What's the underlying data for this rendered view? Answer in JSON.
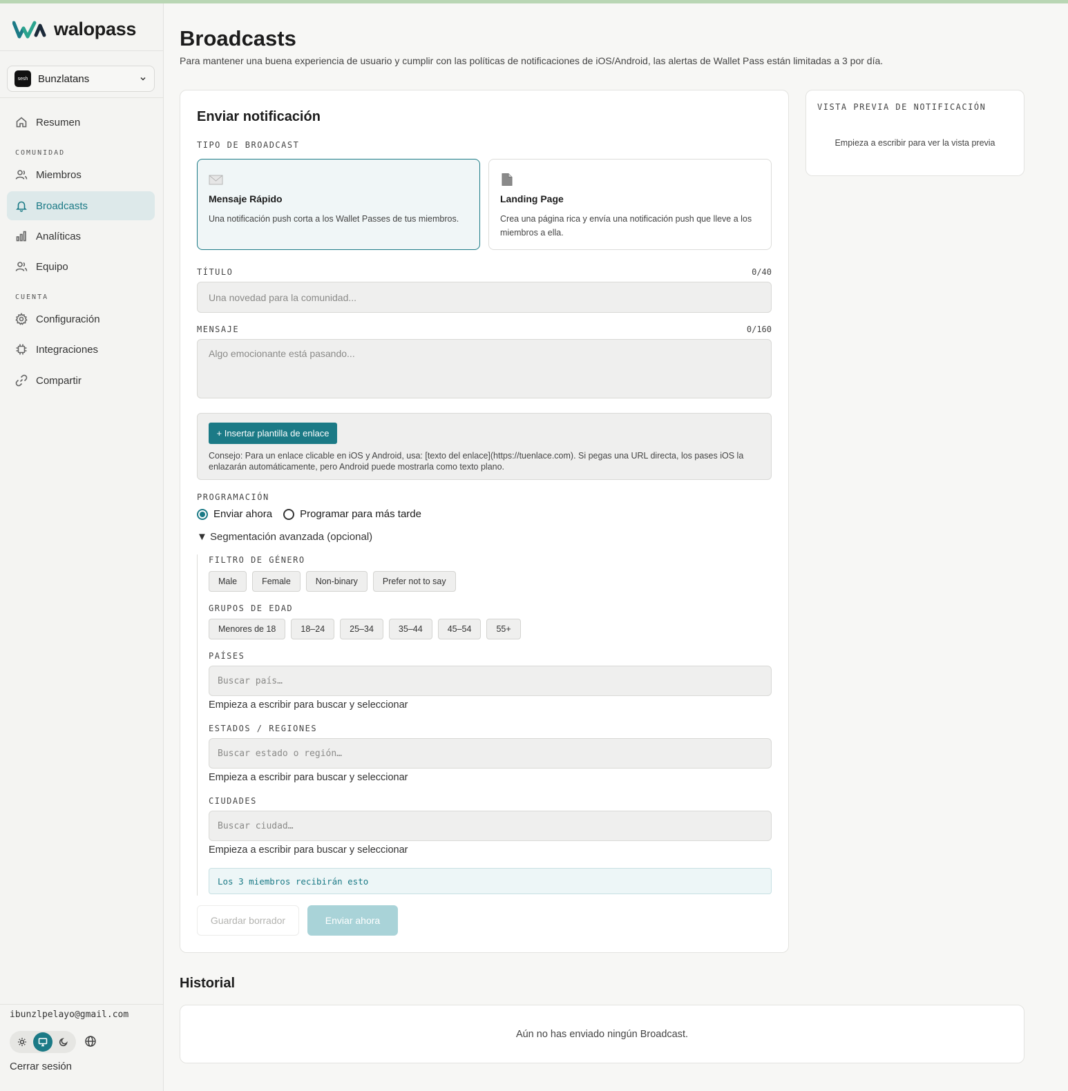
{
  "brand": {
    "name": "walopass",
    "accent": "#1b7a86"
  },
  "workspace": {
    "avatar_text": "sesh",
    "name": "Bunzlatans"
  },
  "nav": {
    "overview": "Resumen",
    "section_community": "COMUNIDAD",
    "members": "Miembros",
    "broadcasts": "Broadcasts",
    "analytics": "Analíticas",
    "team": "Equipo",
    "section_account": "CUENTA",
    "settings": "Configuración",
    "integrations": "Integraciones",
    "share": "Compartir"
  },
  "account": {
    "email": "ibunzlpelayo@gmail.com",
    "logout": "Cerrar sesión",
    "theme_selected": "system"
  },
  "header": {
    "title": "Broadcasts",
    "subtitle": "Para mantener una buena experiencia de usuario y cumplir con las políticas de notificaciones de iOS/Android, las alertas de Wallet Pass están limitadas a 3 por día."
  },
  "form": {
    "title": "Enviar notificación",
    "type_label": "TIPO DE BROADCAST",
    "types": [
      {
        "name": "Mensaje Rápido",
        "desc": "Una notificación push corta a los Wallet Passes de tus miembros.",
        "icon": "envelope-icon",
        "selected": true
      },
      {
        "name": "Landing Page",
        "desc": "Crea una página rica y envía una notificación push que lleve a los miembros a ella.",
        "icon": "document-icon",
        "selected": false
      }
    ],
    "title_field": {
      "label": "TÍTULO",
      "counter": "0/40",
      "placeholder": "Una novedad para la comunidad...",
      "value": ""
    },
    "message_field": {
      "label": "MENSAJE",
      "counter": "0/160",
      "placeholder": "Algo emocionante está pasando...",
      "value": ""
    },
    "link_template": {
      "button": "+ Insertar plantilla de enlace",
      "tip": "Consejo: Para un enlace clicable en iOS y Android, usa: [texto del enlace](https://tuenlace.com). Si pegas una URL directa, los pases iOS la enlazarán automáticamente, pero Android puede mostrarla como texto plano."
    },
    "schedule": {
      "label": "PROGRAMACIÓN",
      "options": [
        "Enviar ahora",
        "Programar para más tarde"
      ],
      "selected": "Enviar ahora"
    },
    "segmentation": {
      "toggle": "▼  Segmentación avanzada (opcional)",
      "gender_label": "FILTRO DE GÉNERO",
      "genders": [
        "Male",
        "Female",
        "Non-binary",
        "Prefer not to say"
      ],
      "age_label": "GRUPOS DE EDAD",
      "ages": [
        "Menores de 18",
        "18–24",
        "25–34",
        "35–44",
        "45–54",
        "55+"
      ],
      "countries": {
        "label": "PAÍSES",
        "placeholder": "Buscar país…",
        "help": "Empieza a escribir para buscar y seleccionar"
      },
      "regions": {
        "label": "ESTADOS / REGIONES",
        "placeholder": "Buscar estado o región…",
        "help": "Empieza a escribir para buscar y seleccionar"
      },
      "cities": {
        "label": "CIUDADES",
        "placeholder": "Buscar ciudad…",
        "help": "Empieza a escribir para buscar y seleccionar"
      },
      "reach": "Los 3 miembros recibirán esto"
    },
    "actions": {
      "draft": "Guardar borrador",
      "send": "Enviar ahora"
    }
  },
  "preview": {
    "label": "VISTA PREVIA DE NOTIFICACIÓN",
    "empty": "Empieza a escribir para ver la vista previa"
  },
  "history": {
    "title": "Historial",
    "empty": "Aún no has enviado ningún Broadcast."
  }
}
